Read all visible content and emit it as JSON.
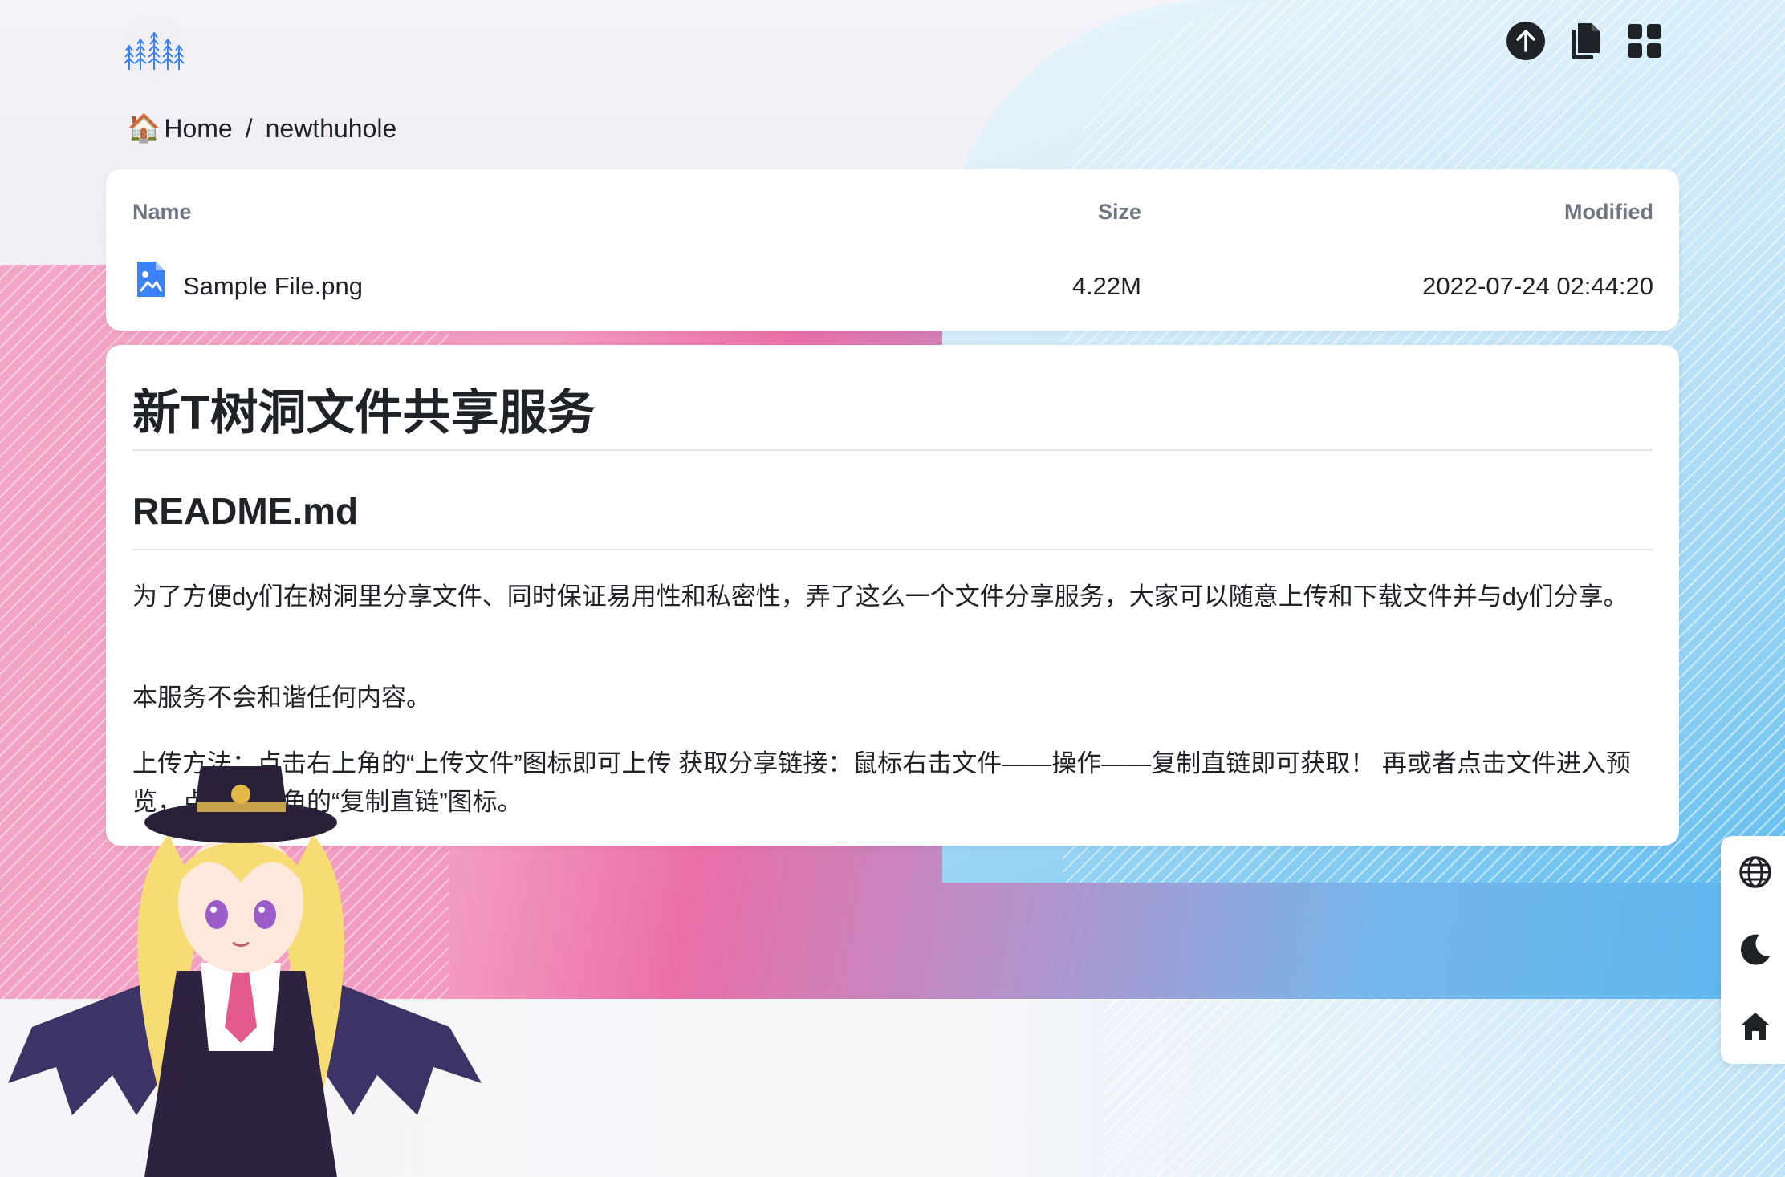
{
  "header": {
    "logo_icon": "forest-logo-icon",
    "actions": [
      {
        "name": "upload-button",
        "icon": "arrow-up-circle-icon"
      },
      {
        "name": "copy-links-button",
        "icon": "documents-icon"
      },
      {
        "name": "view-switch-button",
        "icon": "grid-icon"
      }
    ]
  },
  "breadcrumb": {
    "home_icon": "🏠",
    "home_label": "Home",
    "separator": "/",
    "current": "newthuhole"
  },
  "file_table": {
    "columns": {
      "name": "Name",
      "size": "Size",
      "modified": "Modified"
    },
    "rows": [
      {
        "name": "Sample File.png",
        "size": "4.22M",
        "modified": "2022-07-24 02:44:20",
        "icon": "image-file-icon"
      }
    ]
  },
  "readme": {
    "title": "新T树洞文件共享服务",
    "filename": "README.md",
    "paragraphs": [
      "为了方便dy们在树洞里分享文件、同时保证易用性和私密性，弄了这么一个文件分享服务，大家可以随意上传和下载文件并与dy们分享。",
      "本服务不会和谐任何内容。",
      "上传方法：点击右上角的“上传文件”图标即可上传 获取分享链接：鼠标右击文件——操作——复制直链即可获取！ 再或者点击文件进入预览，点击右上角的“复制直链”图标。"
    ]
  },
  "side_toolbar": [
    {
      "name": "language-button",
      "icon": "globe-icon"
    },
    {
      "name": "dark-mode-button",
      "icon": "moon-icon"
    },
    {
      "name": "home-button",
      "icon": "home-icon"
    }
  ],
  "colors": {
    "accent_blue": "#3b82f6",
    "icon_dark": "#1f2328",
    "card_bg": "#ffffff"
  }
}
